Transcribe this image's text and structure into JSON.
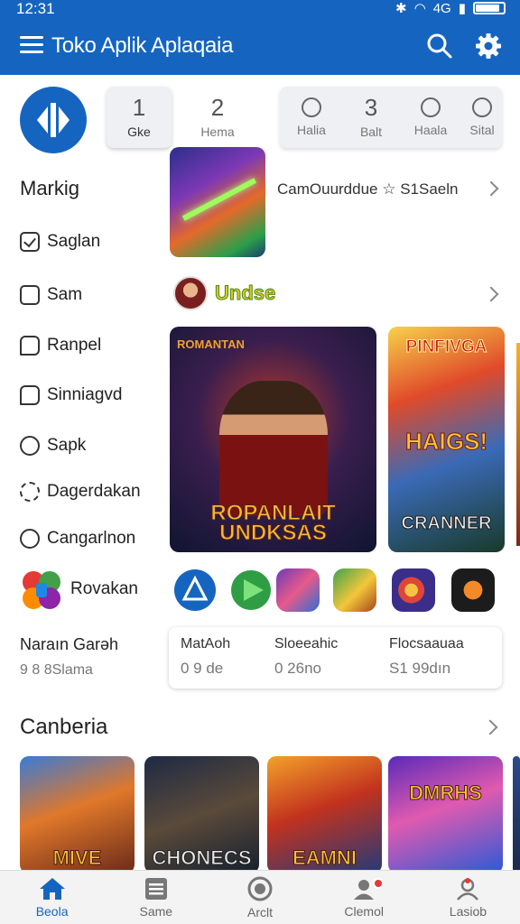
{
  "status_bar": {
    "time": "12:31",
    "network": "4G",
    "battery_level": 0.8
  },
  "app_bar": {
    "title": "Toko Aplik Aplaqaia",
    "icons": [
      "menu-icon",
      "search-icon",
      "settings-gear-icon"
    ]
  },
  "sidebar": {
    "title": "Markig",
    "items": [
      {
        "label": "Saglan",
        "icon": "checkbox-checked-icon"
      },
      {
        "label": "Sam",
        "icon": "checkbox-icon"
      },
      {
        "label": "Ranpel",
        "icon": "chat-bubble-icon"
      },
      {
        "label": "Sinniagvd",
        "icon": "chat-bubble-icon"
      },
      {
        "label": "Sapk",
        "icon": "circle-icon"
      },
      {
        "label": "Dagerdakan",
        "icon": "gear-icon"
      },
      {
        "label": "Cangarlnon",
        "icon": "circle-icon"
      }
    ]
  },
  "tabs": [
    {
      "value": "1",
      "label": "Gke"
    },
    {
      "value": "2",
      "label": "Hema"
    },
    {
      "value": "",
      "label": "Halia"
    },
    {
      "value": "3",
      "label": "Balt"
    },
    {
      "value": "",
      "label": "Haala"
    },
    {
      "value": "",
      "label": "Sital"
    }
  ],
  "featured": {
    "text": "CamOuurddue ☆ S1Saeln"
  },
  "developer": {
    "name": "Undse"
  },
  "banners": [
    {
      "top_text": "ROMANTAN",
      "title_line1": "ROPANLAIT",
      "title_line2": "UNDKSAS"
    },
    {
      "top_text": "PINFIVGA",
      "middle_text": "HAIGS!",
      "bottom_text": "CRANNER"
    }
  ],
  "apps_row": {
    "label": "Rovakan",
    "icons": [
      "triangle-app-icon",
      "play-app-icon",
      "castle-game-icon",
      "house-game-icon",
      "orb-game-icon",
      "flame-app-icon"
    ]
  },
  "stats": {
    "left_title": "Naraın Garəh",
    "left_sub": "9 8 8Slama",
    "items": [
      {
        "label": "MatAoh",
        "value": "0 9 de"
      },
      {
        "label": "Sloeeahic",
        "value": "0 26no"
      },
      {
        "label": "Flocsaauaa",
        "value": "S1 99dın"
      }
    ]
  },
  "section": {
    "title": "Canberia"
  },
  "games": [
    {
      "title": "MIVE"
    },
    {
      "title": "CHONECS"
    },
    {
      "title": "EAMNI"
    },
    {
      "title": "DMRHS"
    }
  ],
  "bottom_nav": [
    {
      "label": "Beola",
      "icon": "home-icon",
      "active": true
    },
    {
      "label": "Same",
      "icon": "list-icon",
      "active": false
    },
    {
      "label": "Arclt",
      "icon": "target-icon",
      "active": false
    },
    {
      "label": "Clemol",
      "icon": "account-notification-icon",
      "active": false
    },
    {
      "label": "Lasiob",
      "icon": "profile-icon",
      "active": false
    }
  ]
}
